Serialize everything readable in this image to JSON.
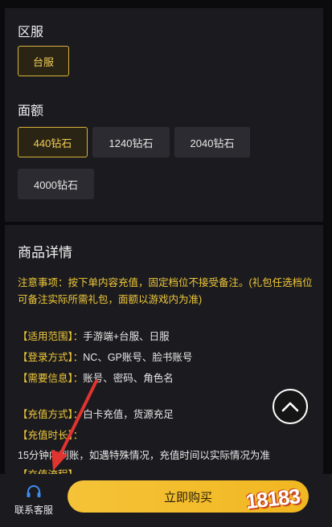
{
  "region": {
    "title": "区服",
    "options": [
      "台服"
    ],
    "selected": "台服"
  },
  "amount": {
    "title": "面额",
    "options": [
      "440钻石",
      "1240钻石",
      "2040钻石",
      "4000钻石"
    ],
    "selected": "440钻石"
  },
  "details": {
    "title": "商品详情",
    "notice": "注意事项：按下单内容充值，固定档位不接受备注。(礼包任选档位可备注实际所需礼包，面额以游戏内为准)",
    "rows": [
      {
        "key": "【适用范围】：",
        "value": "手游端+台服、日服"
      },
      {
        "key": "【登录方式】：",
        "value": "NC、GP账号、脸书账号"
      },
      {
        "key": "【需要信息】：",
        "value": "账号、密码、角色名"
      },
      {
        "key": "【充值方式】：",
        "value": "白卡充值，货源充足"
      },
      {
        "key": "【充值时长】：",
        "value": ""
      }
    ],
    "extra_line": "15分钟内到账，如遇特殊情况，充值时间以实际情况为准",
    "cut_line": "【充值流程】"
  },
  "bottom": {
    "service_label": "联系客服",
    "buy_label": "立即购买"
  },
  "watermark": "18183",
  "colors": {
    "accent": "#f0c83a",
    "background": "#0b0b0d",
    "card": "#1b1b1f",
    "chip": "#2b2b31",
    "arrow": "#e0342f"
  }
}
